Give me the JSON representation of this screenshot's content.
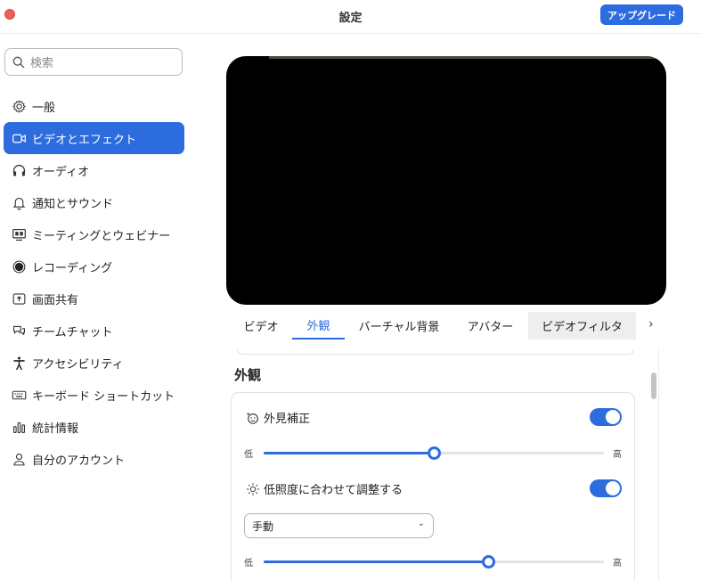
{
  "window": {
    "title": "設定",
    "upgrade_label": "アップグレード"
  },
  "sidebar": {
    "search_placeholder": "検索",
    "items": [
      {
        "label": "一般",
        "icon": "gear-icon"
      },
      {
        "label": "ビデオとエフェクト",
        "icon": "video-camera-icon",
        "active": true
      },
      {
        "label": "オーディオ",
        "icon": "headphones-icon"
      },
      {
        "label": "通知とサウンド",
        "icon": "bell-icon"
      },
      {
        "label": "ミーティングとウェビナー",
        "icon": "meeting-monitor-icon"
      },
      {
        "label": "レコーディング",
        "icon": "record-icon"
      },
      {
        "label": "画面共有",
        "icon": "share-screen-icon"
      },
      {
        "label": "チームチャット",
        "icon": "chat-icon"
      },
      {
        "label": "アクセシビリティ",
        "icon": "accessibility-icon"
      },
      {
        "label": "キーボード ショートカット",
        "icon": "keyboard-icon"
      },
      {
        "label": "統計情報",
        "icon": "statistics-icon"
      },
      {
        "label": "自分のアカウント",
        "icon": "user-icon"
      }
    ]
  },
  "tabs": [
    {
      "label": "ビデオ"
    },
    {
      "label": "外観",
      "active": true
    },
    {
      "label": "バーチャル背景"
    },
    {
      "label": "アバター"
    },
    {
      "label": "ビデオフィルタ",
      "highlight": true
    }
  ],
  "appearance": {
    "section_title": "外観",
    "touch_up": {
      "label": "外見補正",
      "enabled": true,
      "level": 0.5,
      "low": "低",
      "high": "高"
    },
    "low_light": {
      "label": "低照度に合わせて調整する",
      "enabled": true,
      "mode": "手動",
      "level": 0.66,
      "low": "低",
      "high": "高"
    }
  },
  "colors": {
    "accent": "#2d6cdf",
    "close": "#ec5f59"
  }
}
